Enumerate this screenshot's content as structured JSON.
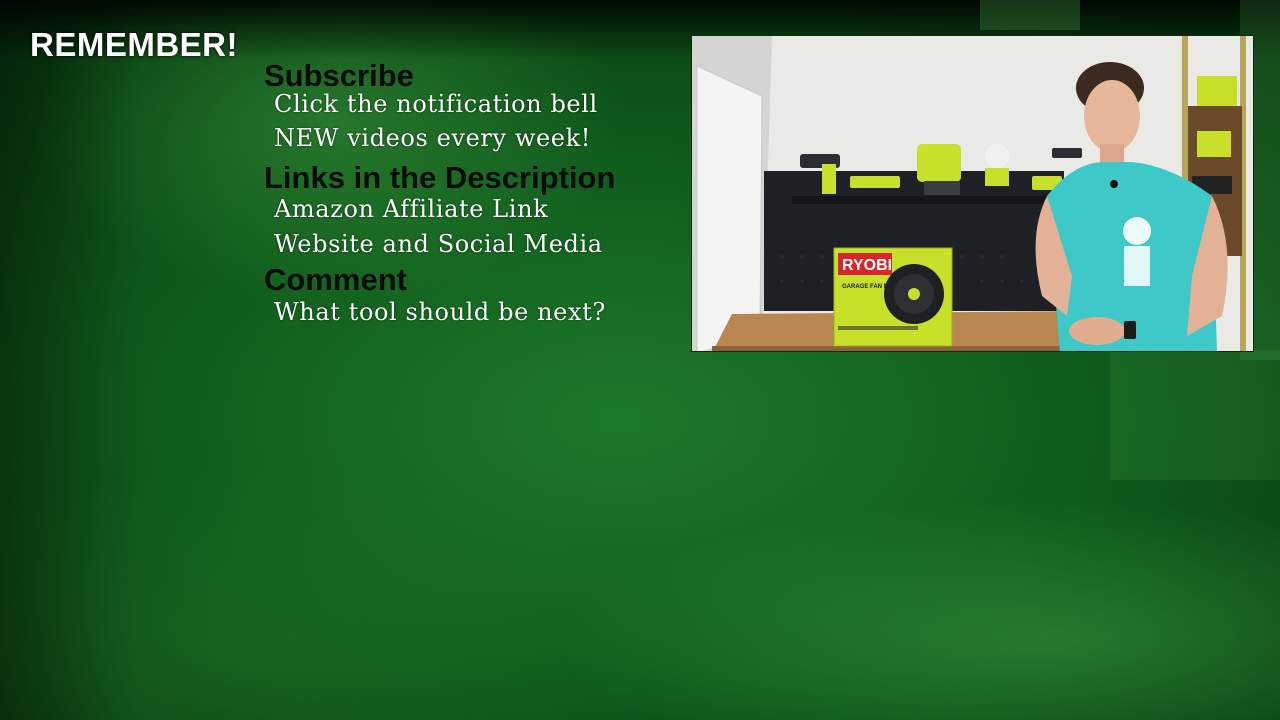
{
  "endscreen": {
    "title": "REMEMBER!",
    "sections": [
      {
        "heading": "Subscribe",
        "lines": [
          "Click the notification bell",
          "NEW videos every week!"
        ]
      },
      {
        "heading": "Links in the Description",
        "lines": [
          "Amazon Affiliate Link",
          "Website and Social Media"
        ]
      },
      {
        "heading": "Comment",
        "lines": [
          "What tool should be next?"
        ]
      }
    ]
  },
  "video": {
    "box_brand": "RYOBI",
    "box_label": "GARAGE FAN MODULE",
    "colors": {
      "ryobi_green": "#c8e02a",
      "ryobi_red": "#d7262c",
      "shirt": "#3ec8c8",
      "pegboard": "#1e2026",
      "bench": "#b88650"
    }
  },
  "colors": {
    "background": "#137025",
    "heading_text": "#0b0b0b",
    "body_text": "#ffffff"
  }
}
